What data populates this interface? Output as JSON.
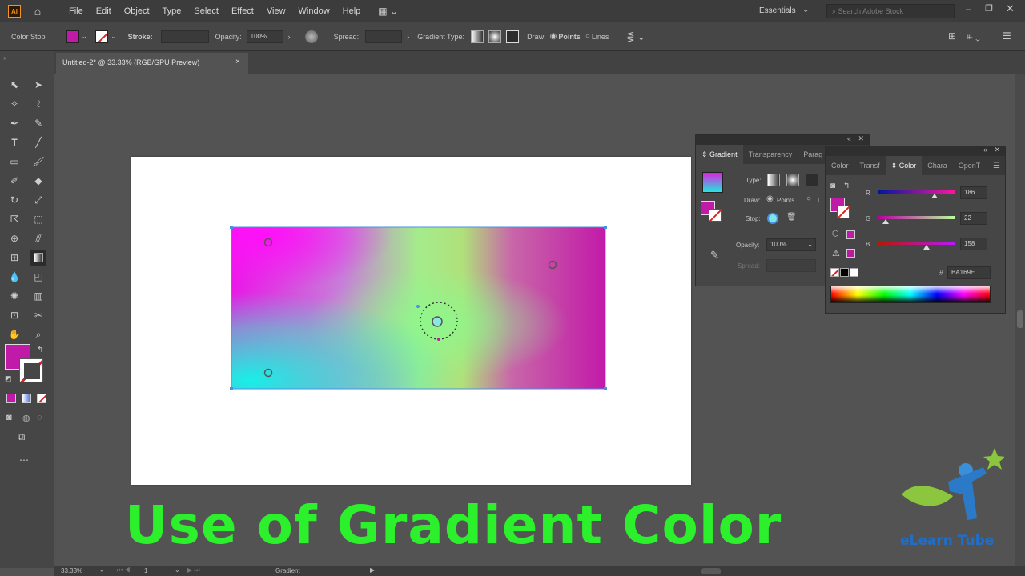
{
  "menu": {
    "items": [
      "File",
      "Edit",
      "Object",
      "Type",
      "Select",
      "Effect",
      "View",
      "Window",
      "Help"
    ]
  },
  "workspace": {
    "label": "Essentials",
    "search_placeholder": "Search Adobe Stock"
  },
  "control_bar": {
    "mode_label": "Color Stop",
    "stroke_label": "Stroke:",
    "opacity_label": "Opacity:",
    "opacity_value": "100%",
    "spread_label": "Spread:",
    "gradient_type_label": "Gradient Type:",
    "draw_label": "Draw:",
    "points_label": "Points",
    "lines_label": "Lines",
    "fill_color": "#c21aa8"
  },
  "document_tab": {
    "title": "Untitled-2* @ 33.33% (RGB/GPU Preview)",
    "close": "×"
  },
  "gradient_panel": {
    "tabs": [
      "Gradient",
      "Transparency",
      "Parag"
    ],
    "type_label": "Type:",
    "draw_label": "Draw:",
    "points_label": "Points",
    "lines_abbrev": "L",
    "stop_label": "Stop:",
    "opacity_label": "Opacity:",
    "opacity_value": "100%",
    "spread_label": "Spread:"
  },
  "color_panel": {
    "tabs": [
      "Color",
      "Transf",
      "Color",
      "Chara",
      "OpenT"
    ],
    "r_label": "R",
    "r_value": "186",
    "g_label": "G",
    "g_value": "22",
    "b_label": "B",
    "b_value": "158",
    "hash_label": "#",
    "hex_value": "BA169E",
    "r_fraction": 0.73,
    "g_fraction": 0.09,
    "b_fraction": 0.62
  },
  "status_bar": {
    "zoom": "33.33%",
    "page": "1",
    "tool": "Gradient"
  },
  "caption": {
    "text": "Use of Gradient Color"
  },
  "brand": {
    "name": "eLearn Tube"
  },
  "colors": {
    "accent_magenta": "#c21aa8",
    "caption_green": "#2df02d",
    "brand_blue": "#1f6ec8"
  }
}
